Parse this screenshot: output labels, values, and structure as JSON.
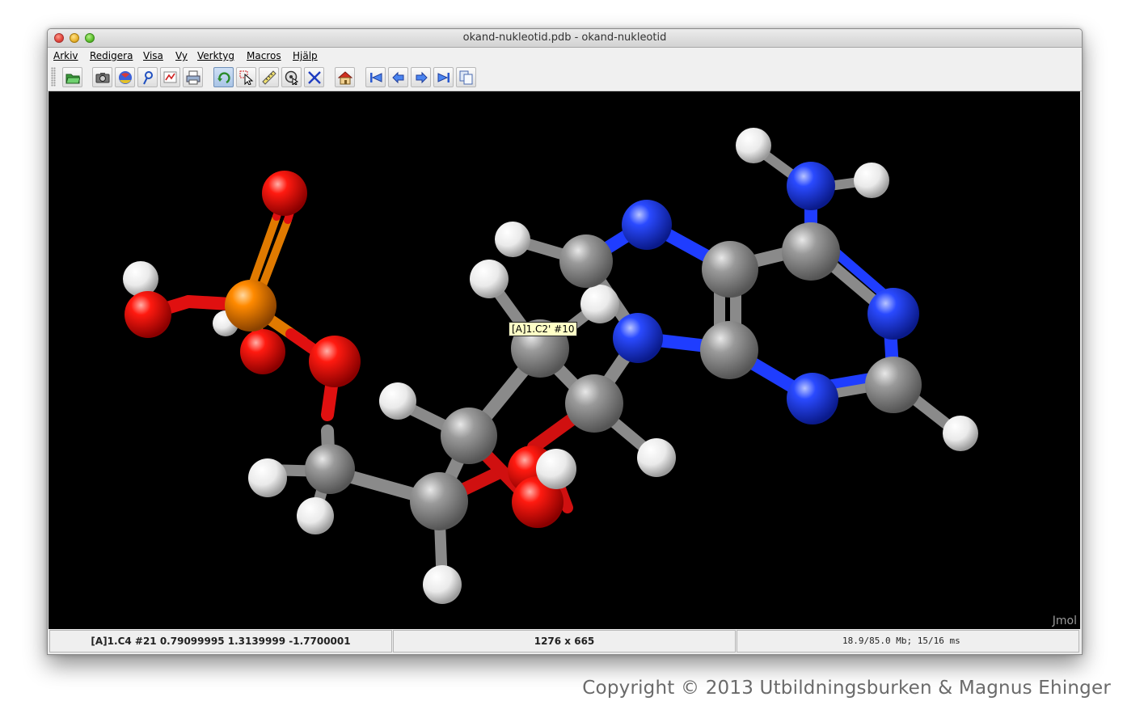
{
  "window": {
    "title": "okand-nukleotid.pdb - okand-nukleotid"
  },
  "menubar": {
    "items": [
      {
        "label": "Arkiv"
      },
      {
        "label": "Redigera"
      },
      {
        "label": "Visa"
      },
      {
        "label": "Vy"
      },
      {
        "label": "Verktyg"
      },
      {
        "label": "Macros"
      },
      {
        "label": "Hjälp"
      }
    ]
  },
  "toolbar": {
    "buttons": [
      {
        "icon": "open-folder-icon"
      },
      {
        "icon": "camera-icon"
      },
      {
        "icon": "color-sphere-icon"
      },
      {
        "icon": "script-editor-icon"
      },
      {
        "icon": "graph-icon"
      },
      {
        "icon": "print-icon"
      },
      {
        "icon": "rotate-icon",
        "active": true
      },
      {
        "icon": "select-pointer-icon"
      },
      {
        "icon": "ruler-icon"
      },
      {
        "icon": "pick-center-icon"
      },
      {
        "icon": "move-icon"
      },
      {
        "icon": "home-icon"
      },
      {
        "icon": "first-frame-icon"
      },
      {
        "icon": "previous-frame-icon"
      },
      {
        "icon": "next-frame-icon"
      },
      {
        "icon": "last-frame-icon"
      },
      {
        "icon": "copy-icon"
      }
    ]
  },
  "viewer": {
    "tooltip": "[A]1.C2' #10",
    "logo": "Jmol",
    "colors": {
      "background": "#000000",
      "carbon": "#808080",
      "hydrogen": "#ffffff",
      "oxygen": "#ff0d0d",
      "nitrogen": "#1f3dff",
      "phosphorus": "#ff8000"
    }
  },
  "statusbar": {
    "atom_info": "[A]1.C4 #21 0.79099995 1.3139999 -1.7700001",
    "dimensions": "1276 x 665",
    "memory": "18.9/85.0 Mb;  15/16 ms"
  },
  "footer": {
    "copyright": "Copyright © 2013 Utbildningsburken & Magnus Ehinger"
  }
}
